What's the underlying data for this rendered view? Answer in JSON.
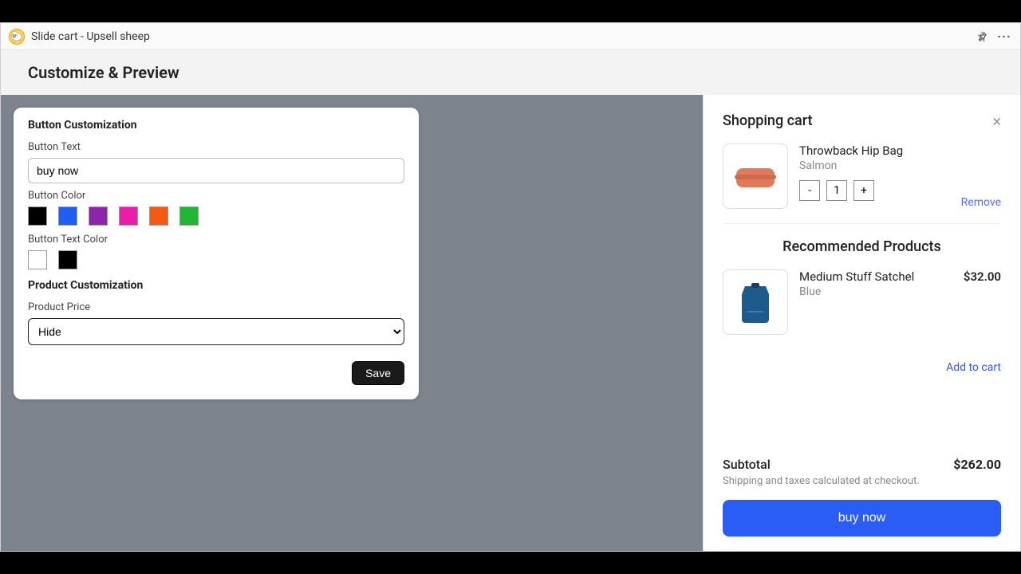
{
  "app": {
    "title": "Slide cart - Upsell sheep"
  },
  "page": {
    "title": "Customize & Preview"
  },
  "customize": {
    "button_section": "Button Customization",
    "button_text_label": "Button Text",
    "button_text_value": "buy now",
    "button_color_label": "Button Color",
    "button_colors": [
      "#000000",
      "#1e5ef3",
      "#8e24aa",
      "#e91ea8",
      "#f45a12",
      "#1fb834"
    ],
    "button_text_color_label": "Button Text Color",
    "button_text_colors": [
      "#ffffff",
      "#000000"
    ],
    "product_section": "Product Customization",
    "product_price_label": "Product Price",
    "product_price_value": "Hide",
    "save_label": "Save"
  },
  "cart": {
    "title": "Shopping cart",
    "item": {
      "name": "Throwback Hip Bag",
      "variant": "Salmon",
      "qty": "1"
    },
    "minus": "-",
    "plus": "+",
    "remove_label": "Remove",
    "recs_title": "Recommended Products",
    "rec": {
      "name": "Medium Stuff Satchel",
      "variant": "Blue",
      "price": "$32.00"
    },
    "add_to_cart_label": "Add to cart",
    "subtotal_label": "Subtotal",
    "subtotal_value": "$262.00",
    "shipping_note": "Shipping and taxes calculated at checkout.",
    "buy_label": "buy now"
  }
}
